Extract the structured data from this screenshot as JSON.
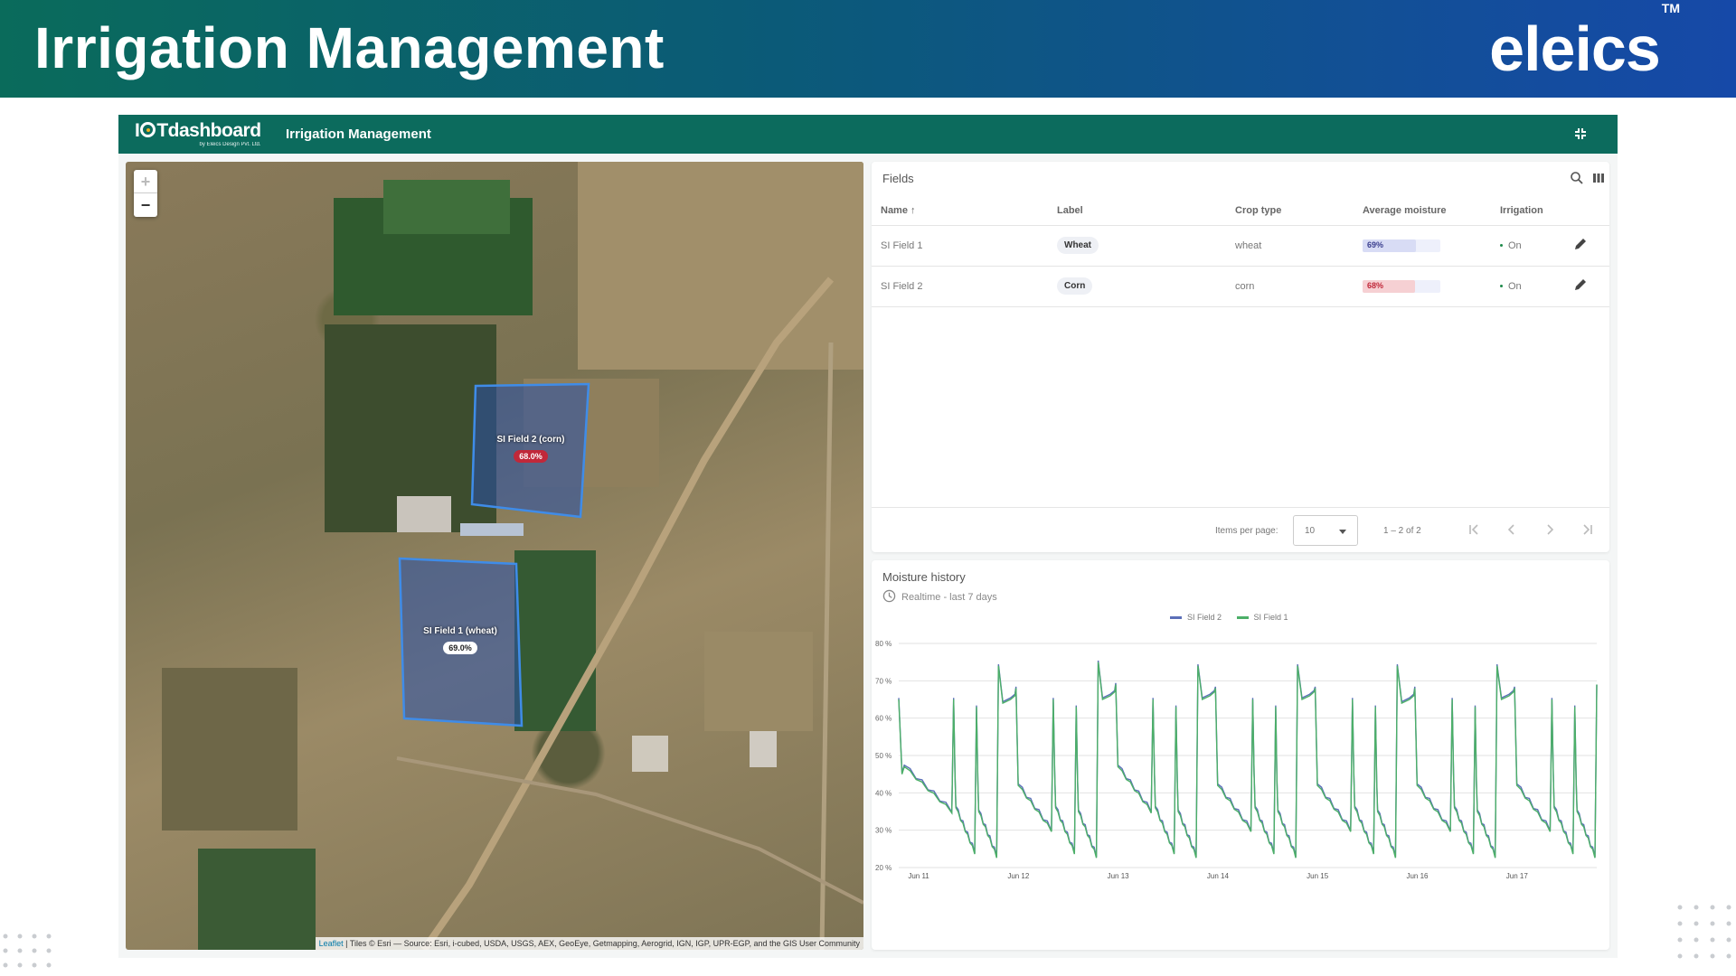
{
  "banner": {
    "title": "Irrigation Management",
    "brand": "eleics",
    "brand_mark": "TM"
  },
  "appbar": {
    "logo_main_a": "I",
    "logo_main_b": "Tdashboard",
    "logo_sub": "by Eleics Design Pvt. Ltd.",
    "title": "Irrigation Management"
  },
  "map": {
    "zoom_in": "+",
    "zoom_out": "−",
    "fields": [
      {
        "name": "SI Field 2 (corn)",
        "moisture": "68.0%",
        "pill_bg": "#c0283a",
        "pill_color": "#ffffff"
      },
      {
        "name": "SI Field 1 (wheat)",
        "moisture": "69.0%",
        "pill_bg": "#ffffff",
        "pill_color": "#222222"
      }
    ],
    "attribution_link": "Leaflet",
    "attribution_text": " | Tiles © Esri — Source: Esri, i-cubed, USDA, USGS, AEX, GeoEye, Getmapping, Aerogrid, IGN, IGP, UPR-EGP, and the GIS User Community"
  },
  "fields_table": {
    "title": "Fields",
    "columns": {
      "name": "Name ↑",
      "label": "Label",
      "crop": "Crop type",
      "moisture": "Average moisture",
      "irrigation": "Irrigation"
    },
    "rows": [
      {
        "name": "SI Field 1",
        "label": "Wheat",
        "crop": "wheat",
        "moisture": 69,
        "moisture_text": "69%",
        "bar_color": "#d8dcf5",
        "text_color": "#3b3f8f",
        "irrigation": "On"
      },
      {
        "name": "SI Field 2",
        "label": "Corn",
        "crop": "corn",
        "moisture": 68,
        "moisture_text": "68%",
        "bar_color": "#f6d0d3",
        "text_color": "#c0283a",
        "irrigation": "On"
      }
    ],
    "pager": {
      "label": "Items per page:",
      "per_page": "10",
      "range": "1 – 2 of 2"
    }
  },
  "moisture_history": {
    "title": "Moisture history",
    "subtitle": "Realtime - last 7 days",
    "colors": {
      "si_field_2": "#5b6fb8",
      "si_field_1": "#4caf68"
    }
  },
  "chart_data": {
    "type": "line",
    "title": "Moisture history",
    "y_ticks": [
      "80 %",
      "70 %",
      "60 %",
      "50 %",
      "40 %",
      "30 %",
      "20 %"
    ],
    "x_ticks": [
      "Jun 11",
      "Jun 12",
      "Jun 13",
      "Jun 14",
      "Jun 15",
      "Jun 16",
      "Jun 17"
    ],
    "ylim": [
      20,
      80
    ],
    "xlim_days": [
      0,
      7
    ],
    "x_tick_days": [
      0.2,
      1.2,
      2.2,
      3.2,
      4.2,
      5.2,
      6.2
    ],
    "legend_placement": "top",
    "cycles": [
      {
        "day": 0.0,
        "high": 65,
        "low": 35
      },
      {
        "day": 0.55,
        "high": 65,
        "low": 24
      },
      {
        "day": 0.78,
        "high": 63,
        "low": 23
      },
      {
        "day": 1.0,
        "high": 74,
        "low": 30,
        "plateau": 64
      },
      {
        "day": 1.55,
        "high": 65,
        "low": 24
      },
      {
        "day": 1.78,
        "high": 63,
        "low": 23
      },
      {
        "day": 2.0,
        "high": 75,
        "low": 35,
        "plateau": 65
      },
      {
        "day": 2.55,
        "high": 65,
        "low": 24
      },
      {
        "day": 2.78,
        "high": 63,
        "low": 23
      },
      {
        "day": 3.0,
        "high": 74,
        "low": 30,
        "plateau": 65
      },
      {
        "day": 3.55,
        "high": 65,
        "low": 24
      },
      {
        "day": 3.78,
        "high": 63,
        "low": 23
      },
      {
        "day": 4.0,
        "high": 74,
        "low": 30,
        "plateau": 65
      },
      {
        "day": 4.55,
        "high": 65,
        "low": 24
      },
      {
        "day": 4.78,
        "high": 63,
        "low": 23
      },
      {
        "day": 5.0,
        "high": 74,
        "low": 30,
        "plateau": 64
      },
      {
        "day": 5.55,
        "high": 65,
        "low": 24
      },
      {
        "day": 5.78,
        "high": 63,
        "low": 23
      },
      {
        "day": 6.0,
        "high": 74,
        "low": 30,
        "plateau": 65
      },
      {
        "day": 6.55,
        "high": 65,
        "low": 24
      },
      {
        "day": 6.78,
        "high": 63,
        "low": 23
      },
      {
        "day": 7.0,
        "high": 69,
        "low": 69
      }
    ],
    "series": [
      {
        "name": "SI Field 2",
        "color": "#5b6fb8"
      },
      {
        "name": "SI Field 1",
        "color": "#4caf68"
      }
    ]
  }
}
